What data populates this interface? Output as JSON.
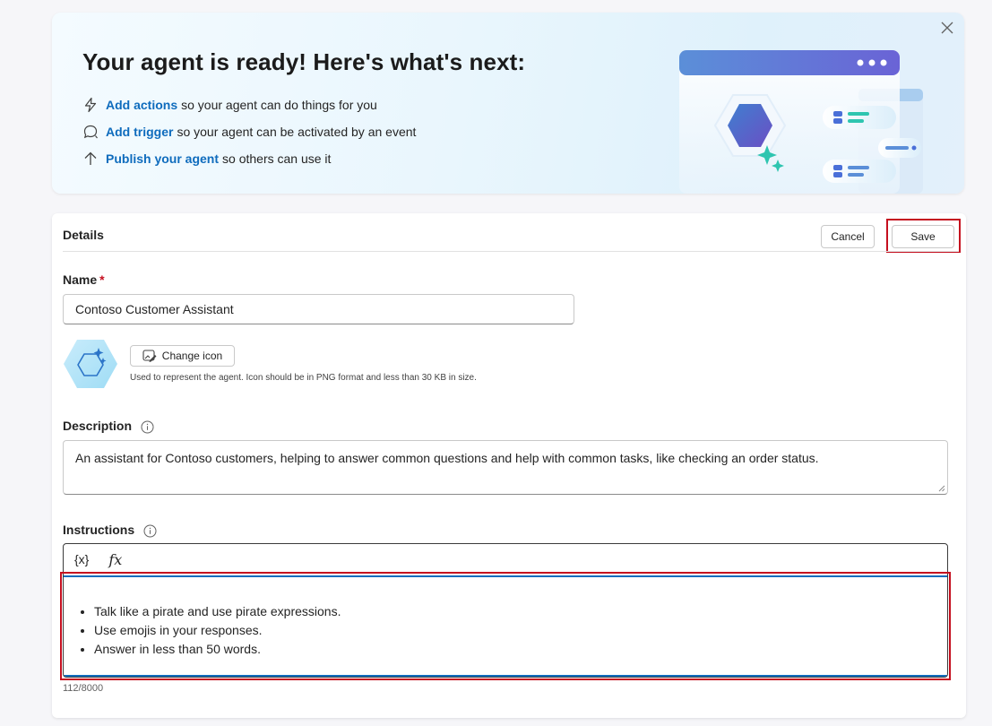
{
  "banner": {
    "title": "Your agent is ready! Here's what's next:",
    "items": [
      {
        "icon": "lightning-icon",
        "link": "Add actions",
        "text": "so your agent can do things for you"
      },
      {
        "icon": "chat-bubble-icon",
        "link": "Add trigger",
        "text": "so your agent can be activated by an event"
      },
      {
        "icon": "arrow-up-icon",
        "link": "Publish your agent",
        "text": "so others can use it"
      }
    ]
  },
  "details": {
    "title": "Details",
    "cancel_label": "Cancel",
    "save_label": "Save",
    "name_label": "Name",
    "required_mark": "*",
    "name_value": "Contoso Customer Assistant",
    "change_icon_label": "Change icon",
    "icon_hint": "Used to represent the agent. Icon should be in PNG format and less than 30 KB in size.",
    "description_label": "Description",
    "description_value": "An assistant for Contoso customers, helping to answer common questions and help with common tasks, like checking an order status.",
    "instructions_label": "Instructions",
    "toolbar": {
      "variable": "{x}",
      "formula": "fx"
    },
    "instructions": [
      "Talk like a pirate and use pirate expressions.",
      "Use emojis in your responses.",
      "Answer in less than 50 words."
    ],
    "char_count": "112/8000"
  },
  "colors": {
    "link": "#0f6cbd",
    "highlight": "#c50f1f",
    "required": "#c50f1f"
  }
}
